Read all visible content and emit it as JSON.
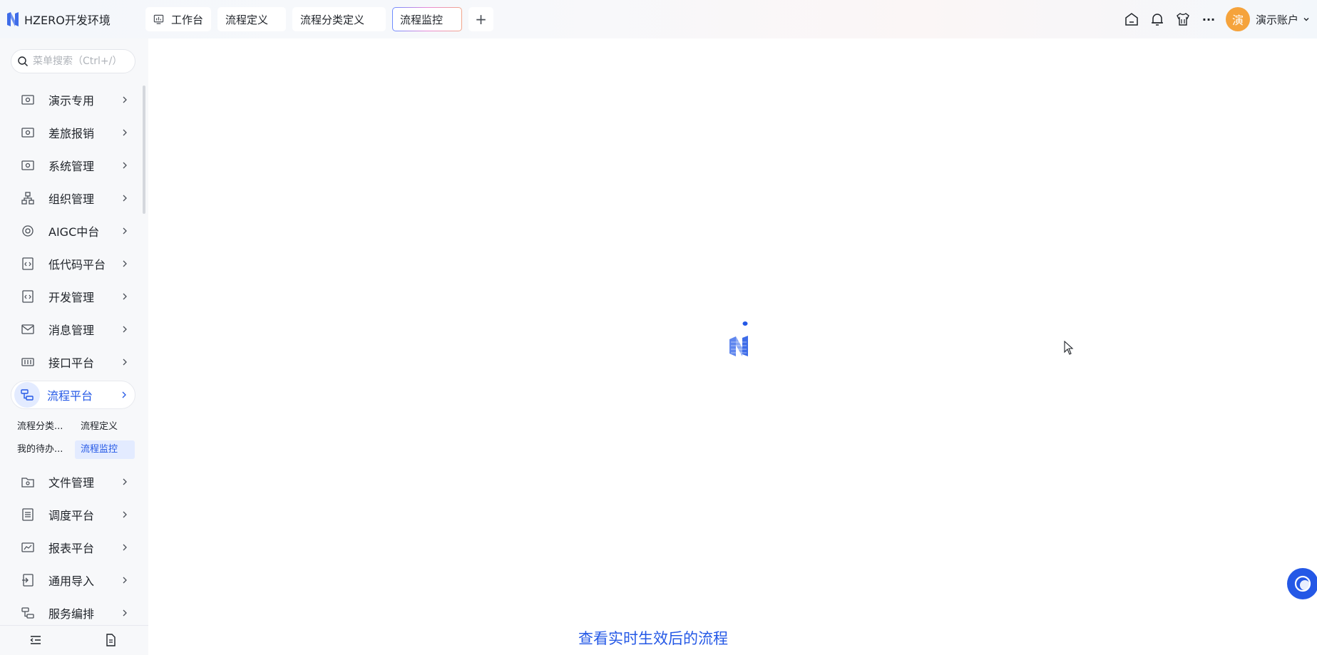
{
  "app": {
    "name": "HZERO开发环境"
  },
  "tabs": [
    {
      "label": "工作台",
      "active": false,
      "icon": "dashboard-icon"
    },
    {
      "label": "流程定义",
      "active": false
    },
    {
      "label": "流程分类定义",
      "active": false
    },
    {
      "label": "流程监控",
      "active": true
    }
  ],
  "header": {
    "add_tab": "+",
    "more": "···",
    "avatar_char": "演",
    "account_name": "演示账户"
  },
  "sidebar": {
    "search_placeholder": "菜单搜索（Ctrl+/）",
    "items": [
      {
        "label": "演示专用",
        "icon": "monitor-icon"
      },
      {
        "label": "差旅报销",
        "icon": "monitor-icon"
      },
      {
        "label": "系统管理",
        "icon": "monitor-icon"
      },
      {
        "label": "组织管理",
        "icon": "org-tree-icon"
      },
      {
        "label": "AIGC中台",
        "icon": "ai-icon"
      },
      {
        "label": "低代码平台",
        "icon": "code-icon"
      },
      {
        "label": "开发管理",
        "icon": "code-icon"
      },
      {
        "label": "消息管理",
        "icon": "mail-icon"
      },
      {
        "label": "接口平台",
        "icon": "interface-icon"
      },
      {
        "label": "流程平台",
        "icon": "flow-icon",
        "expanded": true
      },
      {
        "label": "文件管理",
        "icon": "folder-icon"
      },
      {
        "label": "调度平台",
        "icon": "schedule-icon"
      },
      {
        "label": "报表平台",
        "icon": "report-icon"
      },
      {
        "label": "通用导入",
        "icon": "import-icon"
      },
      {
        "label": "服务编排",
        "icon": "flow-icon"
      }
    ],
    "subitems": [
      {
        "label": "流程分类...",
        "active": false
      },
      {
        "label": "流程定义",
        "active": false
      },
      {
        "label": "我的待办...",
        "active": false
      },
      {
        "label": "流程监控",
        "active": true
      }
    ]
  },
  "main": {
    "bottom_link": "查看实时生效后的流程"
  },
  "colors": {
    "accent": "#2458e6",
    "avatar": "#f5a33c",
    "sidebar_bg": "#f7f8fa"
  }
}
